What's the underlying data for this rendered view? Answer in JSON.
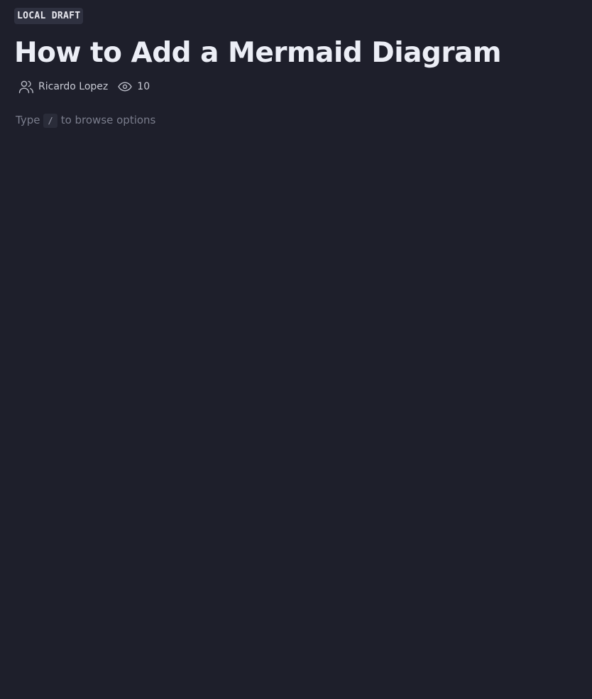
{
  "document": {
    "status_badge": "LOCAL DRAFT",
    "title": "How to Add a Mermaid Diagram",
    "author": "Ricardo Lopez",
    "views_count": "10",
    "icons": {
      "author": "users-icon",
      "views": "eye-icon"
    }
  },
  "editor": {
    "placeholder_prefix": "Type",
    "placeholder_key": "/",
    "placeholder_suffix": "to browse options"
  },
  "colors": {
    "background": "#1e1f2b",
    "title": "#eceef6",
    "muted_text": "#7a7d8c",
    "badge_bg": "#2f3140"
  }
}
